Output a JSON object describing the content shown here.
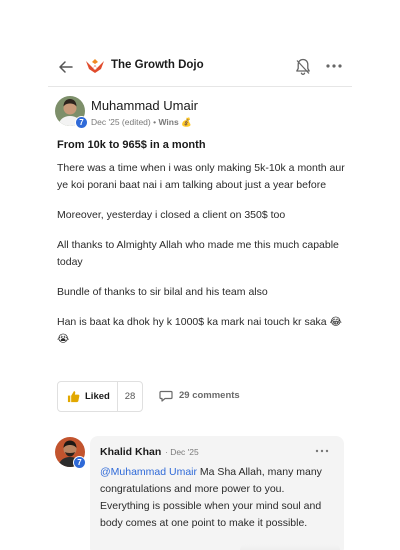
{
  "header": {
    "group_name": "The Growth Dojo",
    "icons": {
      "back": "back-arrow-icon",
      "logo": "growth-dojo-logo",
      "bell": "bell-icon",
      "more": "more-horizontal-icon"
    }
  },
  "post": {
    "author": {
      "name": "Muhammad Umair",
      "level": "7"
    },
    "meta": {
      "date": "Dec '25 (edited)",
      "separator": " • ",
      "category": "Wins",
      "category_emoji": "💰"
    },
    "title": "From 10k to 965$ in a month",
    "paragraphs": [
      "There was a time when i was only making 5k-10k a month aur ye koi porani baat nai i am talking about just a year before",
      "Moreover, yesterday i closed a client on 350$ too",
      "All thanks to Almighty Allah who made me this much capable today",
      "Bundle of thanks to sir bilal and his team also",
      "Han is baat ka dhok hy k 1000$ ka mark nai touch kr saka 😂😭"
    ]
  },
  "actions": {
    "like_label": "Liked",
    "like_count": "28",
    "comments_label": "29 comments",
    "colors": {
      "like_icon": "#e2a800"
    }
  },
  "comment": {
    "author": {
      "name": "Khalid Khan",
      "level": "7"
    },
    "date": "· Dec '25",
    "mention": "@Muhammad Umair",
    "text": " Ma Sha Allah, many many congratulations and more power to you. Everything is possible when your mind soul and body comes at one point to make it possible."
  },
  "colors": {
    "accent": "#2f6ad8",
    "text": "#1a1a1a",
    "muted": "#7a7a7a"
  }
}
